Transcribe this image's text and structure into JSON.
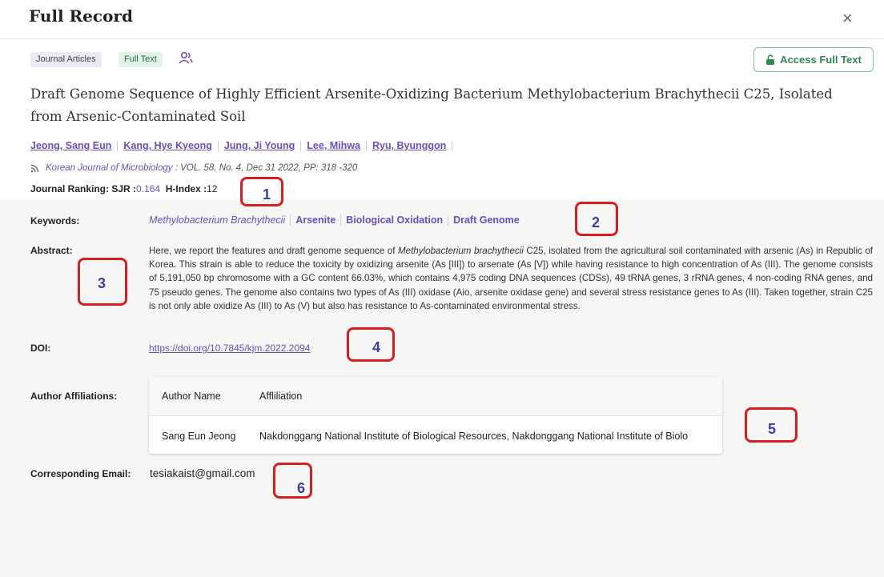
{
  "header": {
    "title": "Full Record",
    "close_label": "×"
  },
  "tags": {
    "journal_articles": "Journal Articles",
    "full_text": "Full Text"
  },
  "access_button": {
    "label": "Access Full Text"
  },
  "paper": {
    "title": "Draft Genome Sequence of Highly Efficient Arsenite-Oxidizing Bacterium Methylobacterium Brachythecii C25, Isolated from Arsenic-Contaminated Soil",
    "authors": [
      "Jeong, Sang Eun",
      "Kang, Hye Kyeong",
      "Jung, Ji Young",
      "Lee, Mihwa",
      "Ryu, Byunggon"
    ],
    "journal_name": "Korean Journal of Microbiology",
    "journal_details": " : VOL. 58, No. 4, Dec 31 2022, PP: 318 -320",
    "ranking_label": "Journal Ranking:",
    "sjr_label": "SJR :",
    "sjr_value": "0.164",
    "hindex_label": "H-Index :",
    "hindex_value": "12"
  },
  "details": {
    "keywords_label": "Keywords:",
    "keywords": [
      "Methylobacterium Brachythecii",
      "Arsenite",
      "Biological Oxidation",
      "Draft Genome"
    ],
    "abstract_label": "Abstract:",
    "abstract_pre": "Here, we report the features and draft genome sequence of ",
    "abstract_italic": "Methylobacterium brachythecii",
    "abstract_post": " C25, isolated from the agricultural soil contaminated with arsenic (As) in Republic of Korea. This strain is able to reduce the toxicity by oxidizing arsenite (As [III]) to arsenate (As [V]) while having resistance to high concentration of As (III). The genome consists of 5,191,050 bp chromosome with a GC content 66.03%, which contains 4,975 coding DNA sequences (CDSs), 49 tRNA genes, 3 rRNA genes, 4 non-coding RNA genes, and 75 pseudo genes. The genome also contains two types of As (III) oxidase (Aio, arsenite oxidase gene) and several stress resistance genes to As (III). Taken together, strain C25 is not only able oxidize As (III) to As (V) but also has resistance to As-contaminated environmental stress.",
    "doi_label": "DOI:",
    "doi": "https://doi.org/10.7845/kjm.2022.2094",
    "affiliations_label": "Author Affiliations:",
    "affiliations_headers": [
      "Author Name",
      "Affliliation"
    ],
    "affiliations_rows": [
      {
        "name": "Sang Eun Jeong",
        "affiliation": "Nakdonggang National Institute of Biological Resources, Nakdonggang National Institute of Biolo"
      }
    ],
    "email_label": "Corresponding Email:",
    "email": "tesiakaist@gmail.com"
  },
  "annotations": [
    "1",
    "2",
    "3",
    "4",
    "5",
    "6"
  ],
  "colors": {
    "accent": "#6a4fc4",
    "annotation": "#d81e1e",
    "annotation_number": "#3b3fa8",
    "access_green": "#2e8a52"
  }
}
